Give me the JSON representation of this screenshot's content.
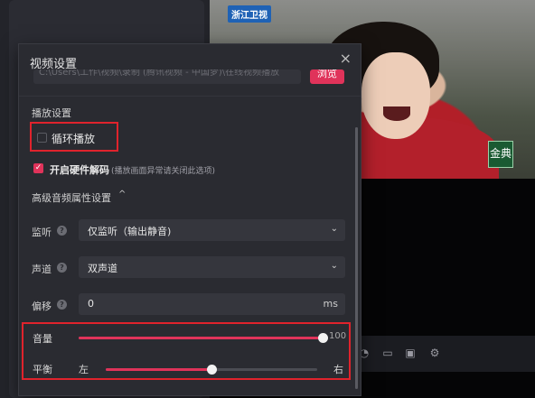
{
  "video": {
    "channel_logo": "浙江卫视",
    "corner_logo": "金典"
  },
  "dialog": {
    "title": "视频设置",
    "close_icon": "×",
    "partial_path": "C:\\Users\\工作\\视频\\录制 (腾讯视频 - 中国梦)\\在线视频播放",
    "browse_label": "浏览",
    "playback_section": "播放设置",
    "loop_label": "循环播放",
    "loop_checked": false,
    "hw_decode_label": "开启硬件解码",
    "hw_decode_note": "(播放画面异常请关闭此选项)",
    "hw_decode_checked": true,
    "advanced_title": "高级音频属性设置",
    "advanced_arrow": "^",
    "monitor": {
      "label": "监听",
      "help": "?",
      "value": "仅监听（输出静音)"
    },
    "channel": {
      "label": "声道",
      "help": "?",
      "value": "双声道"
    },
    "offset": {
      "label": "偏移",
      "help": "?",
      "value": "0",
      "unit": "ms"
    },
    "volume": {
      "label": "音量",
      "value": 100,
      "display": "100"
    },
    "balance": {
      "label": "平衡",
      "left_label": "左",
      "right_label": "右",
      "value": 0.5
    },
    "caret_icon": "⌄"
  },
  "colors": {
    "accent": "#e0335a",
    "highlight_box": "#e0232c"
  }
}
